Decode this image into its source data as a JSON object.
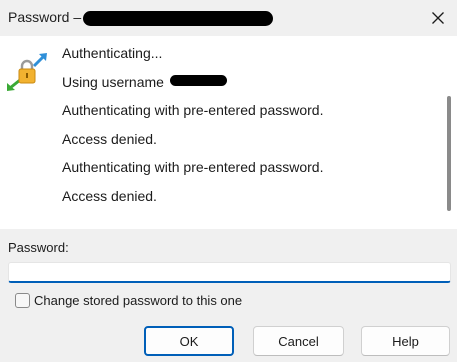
{
  "window": {
    "title": "Password –",
    "close_glyph": "✕"
  },
  "log": {
    "icon": "lock-key-transfer-icon",
    "lines": [
      "Authenticating...",
      "Using username",
      "Authenticating with pre-entered password.",
      "Access denied.",
      "Authenticating with pre-entered password.",
      "Access denied."
    ]
  },
  "password": {
    "label": "Password:",
    "value": ""
  },
  "checkbox": {
    "label": "Change stored password to this one",
    "checked": false
  },
  "buttons": {
    "ok": "OK",
    "cancel": "Cancel",
    "help": "Help"
  },
  "colors": {
    "accent": "#005fb8",
    "window_bg": "#f0f0f0",
    "panel_bg": "#ffffff"
  }
}
